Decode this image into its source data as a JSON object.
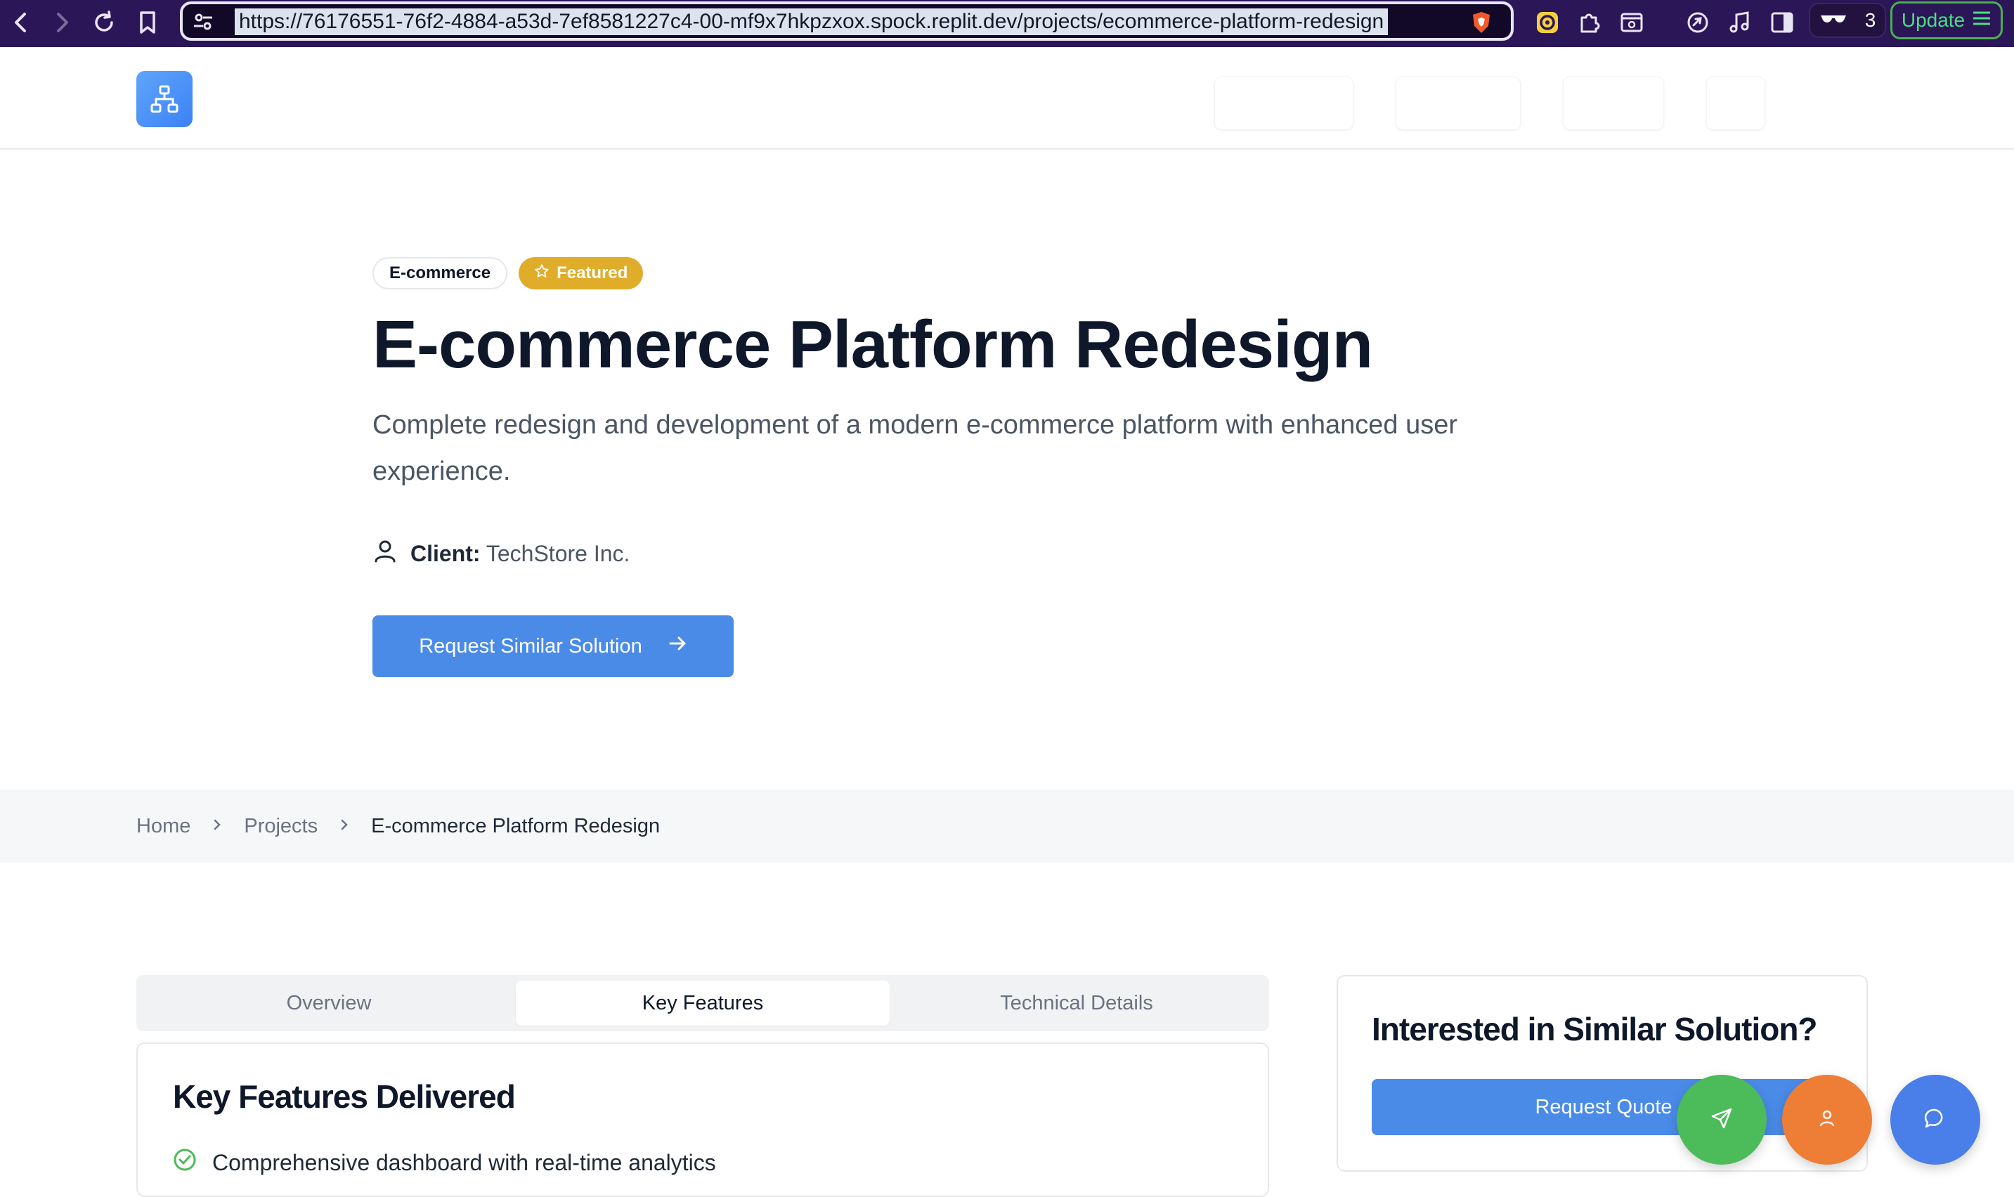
{
  "browser": {
    "url": "https://76176551-76f2-4884-a53d-7ef8581227c4-00-mf9x7hkpzxox.spock.replit.dev/projects/ecommerce-platform-redesign",
    "glasses_count": "3",
    "update_label": "Update"
  },
  "hero": {
    "category_badge": "E-commerce",
    "featured_badge": "Featured",
    "title": "E-commerce Platform Redesign",
    "subtitle": "Complete redesign and development of a modern e-commerce platform with enhanced user experience.",
    "client_label": "Client:",
    "client_value": "TechStore Inc.",
    "cta_label": "Request Similar Solution"
  },
  "breadcrumb": {
    "items": [
      "Home",
      "Projects",
      "E-commerce Platform Redesign"
    ]
  },
  "tabs": [
    {
      "label": "Overview",
      "active": false
    },
    {
      "label": "Key Features",
      "active": true
    },
    {
      "label": "Technical Details",
      "active": false
    }
  ],
  "panel": {
    "heading": "Key Features Delivered",
    "features": [
      "Comprehensive dashboard with real-time analytics"
    ]
  },
  "side_card": {
    "heading": "Interested in Similar Solution?",
    "button_label": "Request Quote"
  },
  "colors": {
    "primary": "#4a8be8",
    "featured": "#e0ad2b",
    "fab_green": "#4cbb5a",
    "fab_orange": "#ee7d36",
    "fab_blue": "#4a7ee8",
    "browser_bg": "#2b1658"
  },
  "icons": {
    "logo": "network-icon",
    "featured": "star-icon",
    "client": "user-icon",
    "cta": "arrow-right-icon",
    "feature_item": "check-circle-icon",
    "fab_send": "send-icon",
    "fab_user": "user-icon",
    "fab_chat": "chat-icon"
  }
}
